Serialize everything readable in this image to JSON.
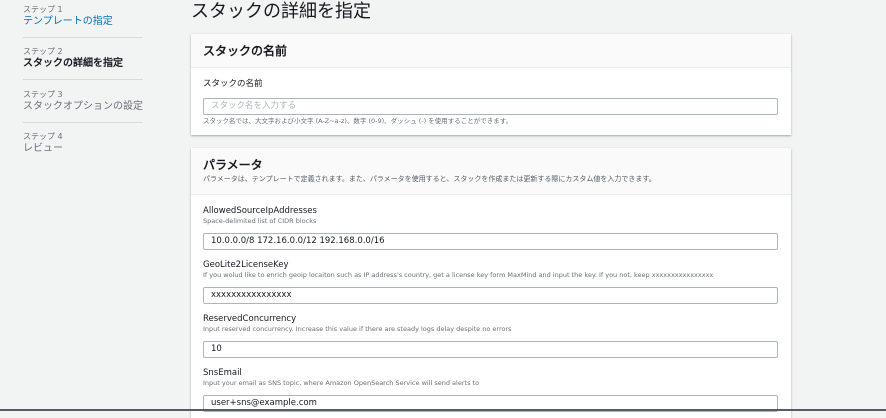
{
  "sidebar": {
    "steps": [
      {
        "number": "ステップ 1",
        "name": "テンプレートの指定"
      },
      {
        "number": "ステップ 2",
        "name": "スタックの詳細を指定"
      },
      {
        "number": "ステップ 3",
        "name": "スタックオプションの設定"
      },
      {
        "number": "ステップ 4",
        "name": "レビュー"
      }
    ]
  },
  "page": {
    "title": "スタックの詳細を指定"
  },
  "stack_name": {
    "section_title": "スタックの名前",
    "label": "スタックの名前",
    "placeholder": "スタック名を入力する",
    "value": "",
    "hint": "スタック名では、大文字および小文字 (A-Z~a-z)、数字 (0-9)、ダッシュ (-) を使用することができます。"
  },
  "parameters": {
    "section_title": "パラメータ",
    "section_desc": "パラメータは、テンプレートで定義されます。また、パラメータを使用すると、スタックを作成または更新する際にカスタム値を入力できます。",
    "fields": [
      {
        "label": "AllowedSourceIpAddresses",
        "description": "Space-delimited list of CIDR blocks",
        "value": "10.0.0.0/8 172.16.0.0/12 192.168.0.0/16"
      },
      {
        "label": "GeoLite2LicenseKey",
        "description": "If you wolud like to enrich geoip locaiton such as IP address's country, get a license key form MaxMind and input the key. If you not, keep xxxxxxxxxxxxxxxx",
        "value": "xxxxxxxxxxxxxxxx"
      },
      {
        "label": "ReservedConcurrency",
        "description": "Input reserved concurrency. Increase this value if there are steady logs delay despite no errors",
        "value": "10"
      },
      {
        "label": "SnsEmail",
        "description": "Input your email as SNS topic, where Amazon OpenSearch Service will send alerts to",
        "value": "user+sns@example.com"
      }
    ]
  }
}
